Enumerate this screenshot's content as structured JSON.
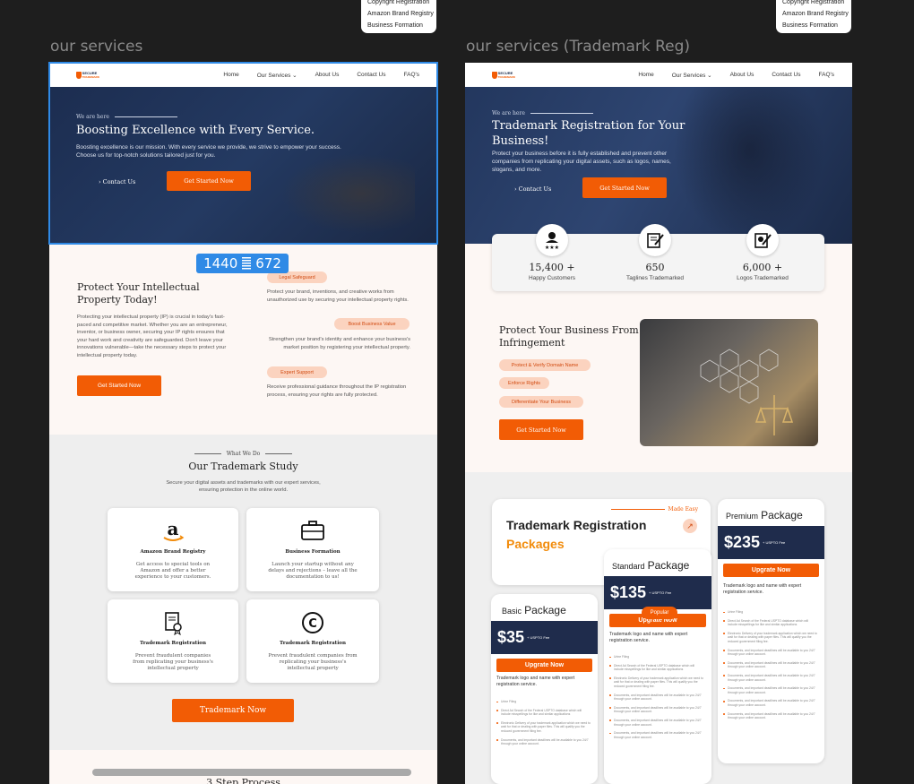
{
  "dropdown_left": {
    "items": [
      "Copyright Registration",
      "Amazon Brand Registry",
      "Business Formation"
    ]
  },
  "dropdown_right": {
    "items": [
      "Copyright Registration",
      "Amazon Brand Registry",
      "Business Formation"
    ]
  },
  "frame_labels": {
    "left": "our services",
    "right": "our services (Trademark Reg)"
  },
  "size_badge": {
    "width": "1440",
    "height": "672"
  },
  "nav": {
    "logo_line1": "SECURE",
    "logo_line2": "TRADEMARK",
    "home": "Home",
    "services": "Our Services",
    "about": "About Us",
    "contact": "Contact Us",
    "faqs": "FAQ's"
  },
  "left": {
    "hero": {
      "tag": "We are here",
      "title": "Boosting Excellence with Every Service.",
      "subtitle": "Boosting excellence is our mission. With every service we provide, we strive to empower your success. Choose us for top-notch solutions tailored just for you.",
      "contact": "› Contact Us",
      "cta": "Get Started Now"
    },
    "protect": {
      "title": "Protect Your Intellectual Property Today!",
      "body": "Protecting your intellectual property (IP) is crucial in today's fast-paced and competitive market. Whether you are an entrepreneur, inventor, or business owner, securing your IP rights ensures that your hard work and creativity are safeguarded. Don't leave your innovations vulnerable—take the necessary steps to protect your intellectual property today.",
      "cta": "Get Started Now",
      "features": [
        {
          "pill": "Legal Safeguard",
          "text": "Protect your brand, inventions, and creative works from unauthorized use by securing your intellectual property rights."
        },
        {
          "pill": "Boost Business Value",
          "text": "Strengthen your brand's identity and enhance your business's market position by registering your intellectual property."
        },
        {
          "pill": "Expert Support",
          "text": "Receive professional guidance throughout the IP registration process, ensuring your rights are fully protected."
        }
      ]
    },
    "study": {
      "tag": "What We Do",
      "title": "Our Trademark Study",
      "subtitle": "Secure your digital assets and trademarks with our expert services, ensuring protection in the online world.",
      "cta": "Trademark Now",
      "cards": [
        {
          "icon": "amazon-icon",
          "title": "Amazon Brand Registry",
          "desc": "Get access to special tools on Amazon and offer a better experience to your customers."
        },
        {
          "icon": "briefcase-icon",
          "title": "Business Formation",
          "desc": "Launch your startup without any delays and rejections – leave all the documentation to us!"
        },
        {
          "icon": "trademark-document-icon",
          "title": "Trademark Registration",
          "desc": "Prevent fraudulent companies from replicating your business's intellectual property"
        },
        {
          "icon": "copyright-icon",
          "title": "Trademark Registration",
          "desc": "Prevent fraudulent companies from replicating your business's intellectual property"
        }
      ]
    },
    "next_title": "3 Step Process"
  },
  "right": {
    "hero": {
      "tag": "We are here",
      "title": "Trademark Registration for Your Business!",
      "subtitle": "Protect your business before it is fully established and prevent other companies from replicating your digital assets, such as logos, names, slogans, and more.",
      "contact": "› Contact Us",
      "cta": "Get Started Now"
    },
    "stats": [
      {
        "icon": "customers-icon",
        "value": "15,400 +",
        "label": "Happy Customers"
      },
      {
        "icon": "tagline-icon",
        "value": "650",
        "label": "Taglines Trademarked"
      },
      {
        "icon": "logo-icon",
        "value": "6,000 +",
        "label": "Logos Trademarked"
      }
    ],
    "infringe": {
      "title": "Protect Your Business From Infringement",
      "pills": [
        "Protect & Verify Domain Name",
        "Enforce Rights",
        "Differentiate Your Business"
      ],
      "cta": "Get Started Now"
    },
    "packages": {
      "made_easy": "Made Easy",
      "title1": "Trademark Registration",
      "title2": "Packages",
      "popular": "Popular",
      "fee": "+ USPTO Fee",
      "upgrade": "Upgrate Now",
      "desc": "Trademark logo and name with expert registration service.",
      "basic": {
        "name1": "Basic",
        "name2": "Package",
        "price": "$35"
      },
      "standard": {
        "name1": "Standard",
        "name2": "Package",
        "price": "$135"
      },
      "premium": {
        "name1": "Premium",
        "name2": "Package",
        "price": "$235"
      },
      "features": [
        "Urine Filing",
        "Direct Ad Search of the Federal USPTO database which will include misspellings for like and similar applications",
        "Electronic Delivery of your trademark application which we need to wait for that or dealing with paper files. This will qualify you the reduced government filing fee.",
        "Documents, and important deadlines will be available to you 24/7 through your online account.",
        "Documents, and important deadlines will be available to you 24/7 through your online account.",
        "Documents, and important deadlines will be available to you 24/7 through your online account.",
        "Documents, and important deadlines will be available to you 24/7 through your online account.",
        "Documents, and important deadlines will be available to you 24/7 through your online account.",
        "Documents, and important deadlines will be available to you 24/7 through your online account."
      ]
    }
  },
  "colors": {
    "accent": "#f25c05",
    "navy": "#1f2c4c",
    "pill_bg": "#fbd3bf",
    "selection": "#2f8ae6"
  }
}
